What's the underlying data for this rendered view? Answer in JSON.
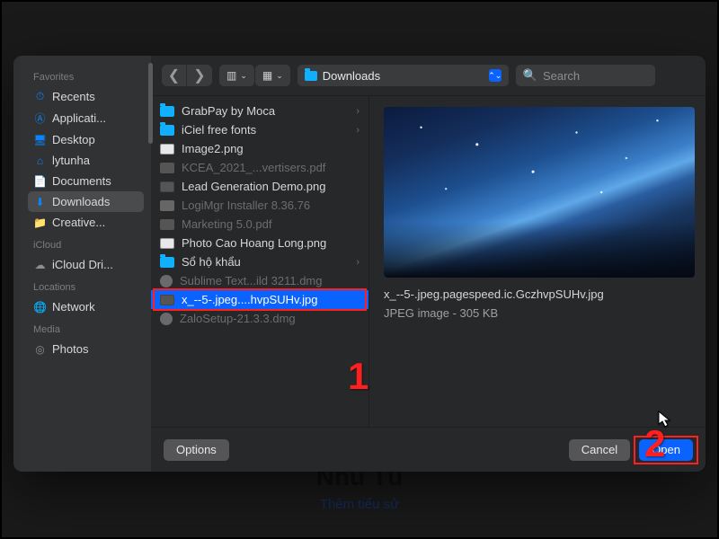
{
  "backdrop": {
    "name": "Nhũ Tú",
    "sub": "Thêm tiểu sử"
  },
  "sidebar": {
    "sections": [
      {
        "title": "Favorites",
        "items": [
          {
            "icon": "clock",
            "label": "Recents"
          },
          {
            "icon": "app",
            "label": "Applicati..."
          },
          {
            "icon": "desktop",
            "label": "Desktop"
          },
          {
            "icon": "house",
            "label": "lytunha"
          },
          {
            "icon": "doc",
            "label": "Documents"
          },
          {
            "icon": "down",
            "label": "Downloads",
            "selected": true
          },
          {
            "icon": "folder",
            "label": "Creative..."
          }
        ]
      },
      {
        "title": "iCloud",
        "items": [
          {
            "icon": "cloud",
            "label": "iCloud Dri..."
          }
        ]
      },
      {
        "title": "Locations",
        "items": [
          {
            "icon": "globe",
            "label": "Network"
          }
        ]
      },
      {
        "title": "Media",
        "items": [
          {
            "icon": "photos",
            "label": "Photos"
          }
        ]
      }
    ]
  },
  "toolbar": {
    "location": "Downloads",
    "search_placeholder": "Search"
  },
  "files": [
    {
      "icon": "folder",
      "label": "GrabPay by Moca",
      "dir": true
    },
    {
      "icon": "folder",
      "label": "iCiel free fonts",
      "dir": true
    },
    {
      "icon": "image",
      "label": "Image2.png"
    },
    {
      "icon": "pdf",
      "label": "KCEA_2021_...vertisers.pdf",
      "dim": true
    },
    {
      "icon": "imaged",
      "label": "Lead Generation Demo.png"
    },
    {
      "icon": "gen",
      "label": "LogiMgr Installer 8.36.76",
      "dim": true
    },
    {
      "icon": "pdf",
      "label": "Marketing 5.0.pdf",
      "dim": true
    },
    {
      "icon": "image",
      "label": "Photo Cao Hoang Long.png"
    },
    {
      "icon": "folder",
      "label": "Sổ hộ khẩu",
      "dir": true
    },
    {
      "icon": "dmg",
      "label": "Sublime Text...ild 3211.dmg",
      "dim": true
    },
    {
      "icon": "imaged",
      "label": "x_--5-.jpeg....hvpSUHv.jpg",
      "selected": true
    },
    {
      "icon": "dmg",
      "label": "ZaloSetup-21.3.3.dmg",
      "dim": true
    }
  ],
  "preview": {
    "name": "x_--5-.jpeg.pagespeed.ic.GczhvpSUHv.jpg",
    "meta": "JPEG image - 305 KB"
  },
  "footer": {
    "options": "Options",
    "cancel": "Cancel",
    "open": "Open"
  },
  "callouts": {
    "one": "1",
    "two": "2"
  }
}
